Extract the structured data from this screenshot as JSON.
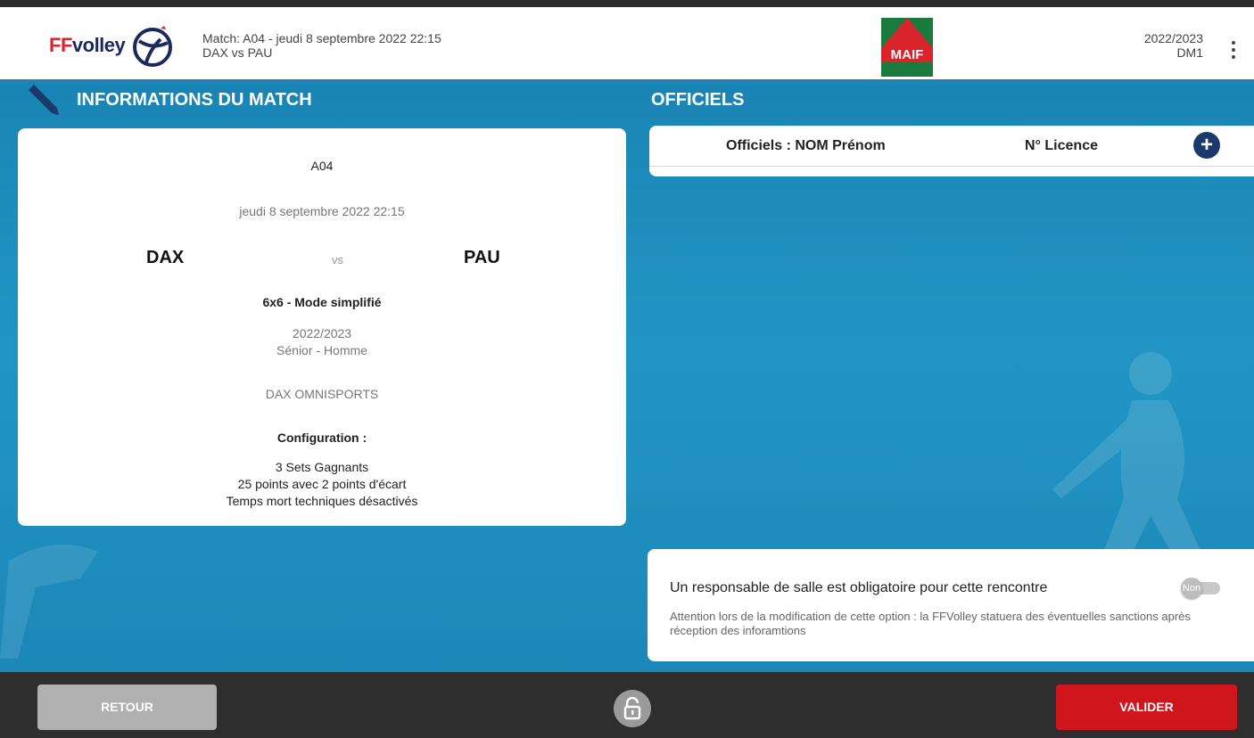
{
  "header": {
    "logo_text_ff": "FF",
    "logo_text_volley": "volley",
    "match_line": "Match: A04 - jeudi 8 septembre 2022 22:15",
    "teams_line": "DAX vs PAU",
    "sponsor": "MAIF",
    "season": "2022/2023",
    "division": "DM1"
  },
  "info": {
    "section_title": "INFORMATIONS DU MATCH",
    "code": "A04",
    "datetime": "jeudi 8 septembre 2022 22:15",
    "home": "DAX",
    "vs": "vs",
    "away": "PAU",
    "mode": "6x6 - Mode simplifié",
    "season": "2022/2023",
    "category": "Sénior - Homme",
    "venue": "DAX OMNISPORTS",
    "config_title": "Configuration :",
    "config_sets": "3 Sets Gagnants",
    "config_points": "25 points avec 2 points d'écart",
    "config_timeouts": "Temps mort techniques désactivés"
  },
  "officials": {
    "section_title": "OFFICIELS",
    "col_name": "Officiels : NOM Prénom",
    "col_license": "N° Licence",
    "add_symbol": "+"
  },
  "responsable": {
    "title": "Un responsable de salle est obligatoire pour cette rencontre",
    "toggle_label": "Non",
    "note": "Attention lors de la modification de cette option : la FFVolley statuera des éventuelles sanctions après réception des inforamtions"
  },
  "footer": {
    "back_label": "RETOUR",
    "validate_label": "VALIDER"
  },
  "colors": {
    "primary_blue": "#1f8ab8",
    "validate_red": "#d0161d",
    "navy": "#1a3a6e"
  }
}
